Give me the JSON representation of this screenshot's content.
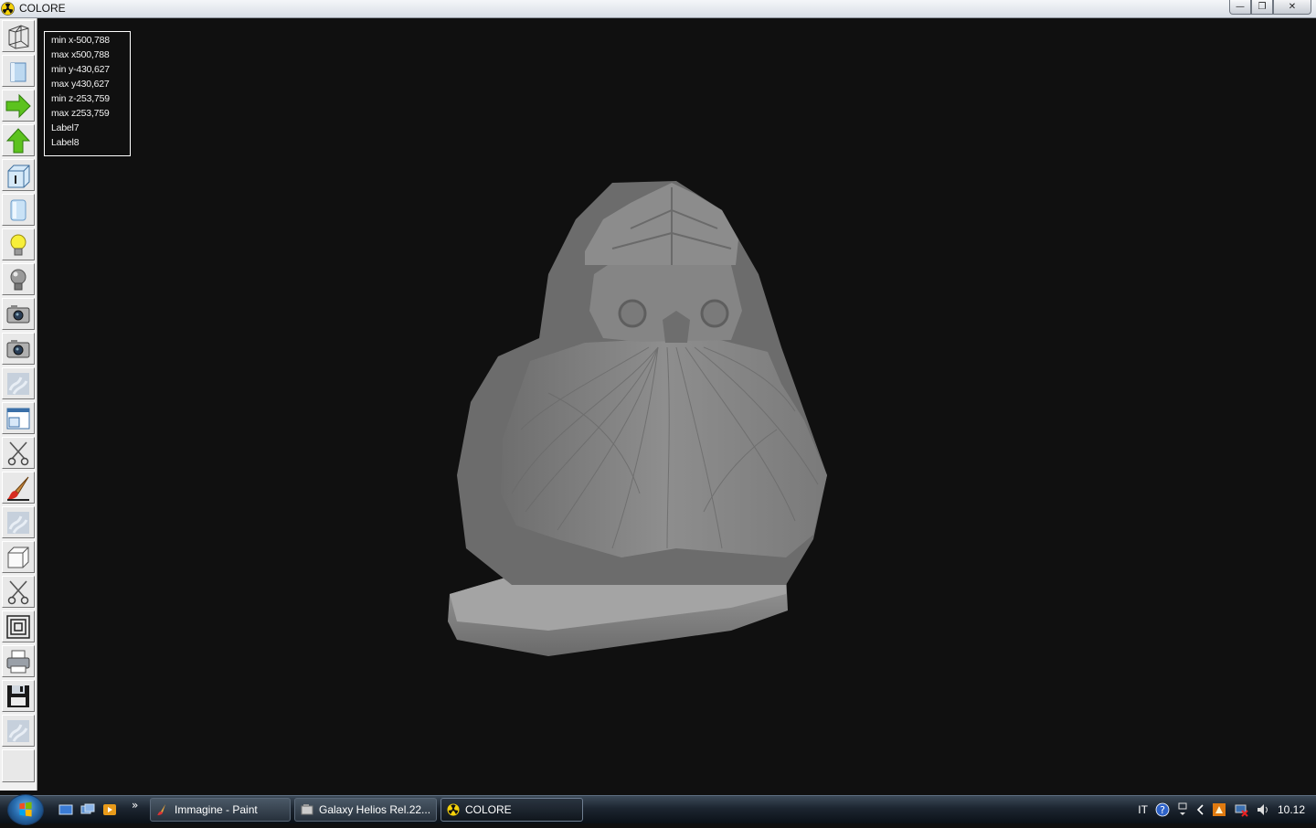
{
  "window": {
    "title": "COLORE",
    "controls": {
      "minimize": "—",
      "restore": "❐",
      "close": "✕"
    }
  },
  "info_panel": {
    "lines": [
      "min x-500,788",
      "max x500,788",
      "min y-430,627",
      "max y430,627",
      "min z-253,759",
      "max z253,759",
      "Label7",
      "Label8"
    ]
  },
  "toolbar": {
    "tools": [
      "wireframe-icon",
      "solid-box-icon",
      "arrow-right-icon",
      "arrow-up-icon",
      "box-info-icon",
      "cylinder-icon",
      "bulb-on-icon",
      "bulb-off-icon",
      "camera-icon",
      "camera-2-icon",
      "texture-icon",
      "window-split-icon",
      "scissors-icon",
      "brush-icon",
      "texture-2-icon",
      "cube-icon",
      "scissors-2-icon",
      "concentric-squares-icon",
      "printer-icon",
      "floppy-disk-icon",
      "texture-3-icon"
    ]
  },
  "taskbar": {
    "quicklaunch_more": "»",
    "tasks": [
      {
        "label": "Immagine - Paint",
        "icon": "paint-icon",
        "active": false
      },
      {
        "label": "Galaxy Helios  Rel.22...",
        "icon": "helios-icon",
        "active": false
      },
      {
        "label": "COLORE",
        "icon": "radiation-icon",
        "active": true
      }
    ],
    "tray": {
      "language": "IT",
      "clock": "10.12"
    }
  },
  "colors": {
    "background": "#101010",
    "model": "#8a8a8a",
    "toolbar": "#f0f0f0",
    "accent_green": "#4caf20"
  }
}
